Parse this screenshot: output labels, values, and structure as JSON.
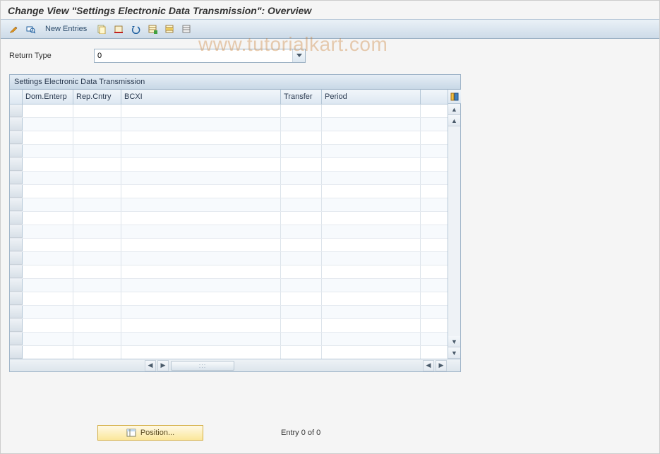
{
  "title": "Change View \"Settings Electronic Data Transmission\": Overview",
  "toolbar": {
    "new_entries_label": "New Entries"
  },
  "filter": {
    "return_type_label": "Return Type",
    "return_type_value": "0"
  },
  "table": {
    "panel_title": "Settings Electronic Data Transmission",
    "columns": {
      "dom_enterp": "Dom.Enterp",
      "rep_cntry": "Rep.Cntry",
      "bcxi": "BCXI",
      "transfer": "Transfer",
      "period": "Period"
    },
    "rows": []
  },
  "footer": {
    "position_label": "Position...",
    "entry_status": "Entry 0 of 0"
  },
  "watermark": "www.tutorialkart.com"
}
